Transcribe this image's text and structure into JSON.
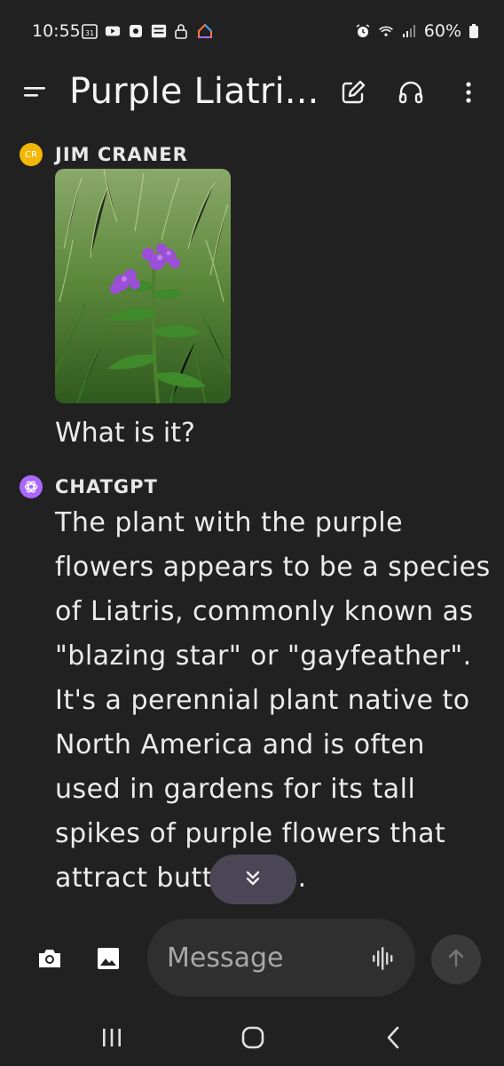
{
  "status_bar": {
    "time": "10:55",
    "battery": "60%",
    "icons_left": [
      "calendar-icon",
      "youtube-icon",
      "messenger-icon",
      "bible-icon",
      "lock-icon",
      "home-icon"
    ],
    "icons_right": [
      "alarm-icon",
      "wifi-icon",
      "signal-icon",
      "battery-icon"
    ],
    "calendar_day": "31"
  },
  "header": {
    "title": "Purple Liatri...",
    "actions": [
      "new-chat-icon",
      "headphones-icon",
      "more-options-icon"
    ]
  },
  "messages": [
    {
      "sender": "JIM CRANER",
      "avatar_initials": "CR",
      "avatar_color": "#f2b705",
      "image": "photo of purple liatris flowers in grass",
      "text": "What is it?"
    },
    {
      "sender": "CHATGPT",
      "avatar_color": "#ab68ff",
      "text": "The plant with the purple flowers appears to be a species of Liatris, commonly known as \"blazing star\" or \"gayfeather\". It's a perennial plant native to North America and is often used in gardens for its tall spikes of purple flowers that attract butterflies."
    }
  ],
  "composer": {
    "placeholder": "Message"
  },
  "colors": {
    "background": "#212121",
    "input_bg": "#2f2f2f",
    "scroll_btn_bg": "#4a4656"
  }
}
